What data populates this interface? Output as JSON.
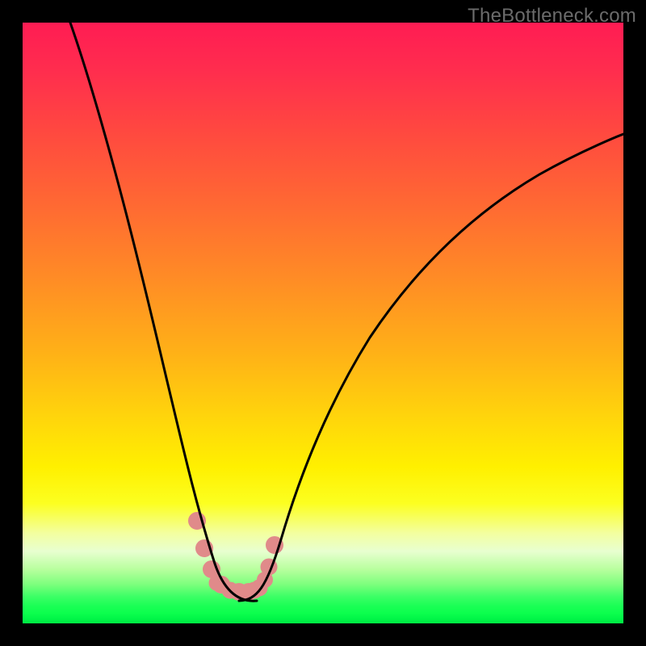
{
  "watermark": "TheBottleneck.com",
  "chart_data": {
    "type": "line",
    "title": "",
    "xlabel": "",
    "ylabel": "",
    "xlim": [
      0,
      100
    ],
    "ylim": [
      0,
      100
    ],
    "grid": false,
    "series": [
      {
        "name": "left-curve",
        "x": [
          8,
          11,
          14,
          17,
          20,
          22,
          24,
          26,
          28,
          30,
          32,
          33.5,
          35,
          36.5,
          38,
          40,
          42,
          44
        ],
        "y": [
          100,
          92,
          83,
          74,
          65,
          58,
          51,
          44,
          37,
          30,
          24,
          19,
          14,
          11,
          9,
          7,
          6,
          5
        ],
        "note": "steep descending curve from top-left toward trough"
      },
      {
        "name": "right-curve",
        "x": [
          36,
          38,
          40,
          43,
          46,
          50,
          55,
          60,
          66,
          72,
          78,
          84,
          90,
          96,
          100
        ],
        "y": [
          5,
          5.5,
          6,
          7.5,
          10,
          15,
          22,
          30,
          38,
          46,
          54,
          61,
          68,
          74,
          78
        ],
        "note": "gentler ascending curve from trough toward upper-right"
      },
      {
        "name": "trough-overlay",
        "x": [
          29,
          30.3,
          31.5,
          33,
          34.5,
          36,
          37.7,
          38.5,
          39.3,
          40.2,
          41,
          42
        ],
        "y": [
          17,
          12.5,
          9,
          6.5,
          5.4,
          5.2,
          5.3,
          5.5,
          6,
          7.3,
          9.5,
          13
        ],
        "color": "#e08a8a",
        "note": "pink blobby overlay marking minimum region"
      }
    ],
    "background_gradient": {
      "direction": "top-to-bottom",
      "stops": [
        {
          "pos": 0,
          "color": "#ff1c53"
        },
        {
          "pos": 42,
          "color": "#ff8a26"
        },
        {
          "pos": 74,
          "color": "#fff000"
        },
        {
          "pos": 95,
          "color": "#3dff66"
        },
        {
          "pos": 100,
          "color": "#00e543"
        }
      ]
    }
  }
}
